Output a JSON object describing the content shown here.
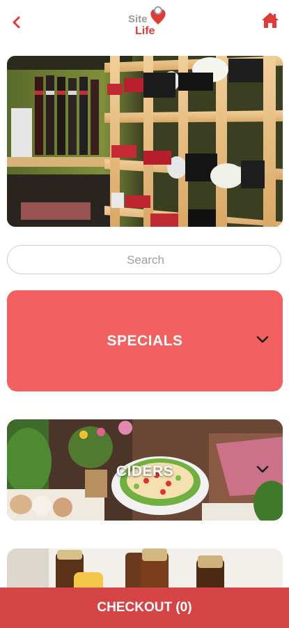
{
  "header": {
    "logo_line1": "Site",
    "logo_line2": "Life"
  },
  "search": {
    "placeholder": "Search"
  },
  "categories": [
    {
      "label": "SPECIALS"
    },
    {
      "label": "CIDERS"
    }
  ],
  "checkout": {
    "label": "CHECKOUT (0)"
  },
  "colors": {
    "accent": "#e03a3a",
    "specials_bg": "#f26060",
    "checkout_bg": "#d64545"
  }
}
